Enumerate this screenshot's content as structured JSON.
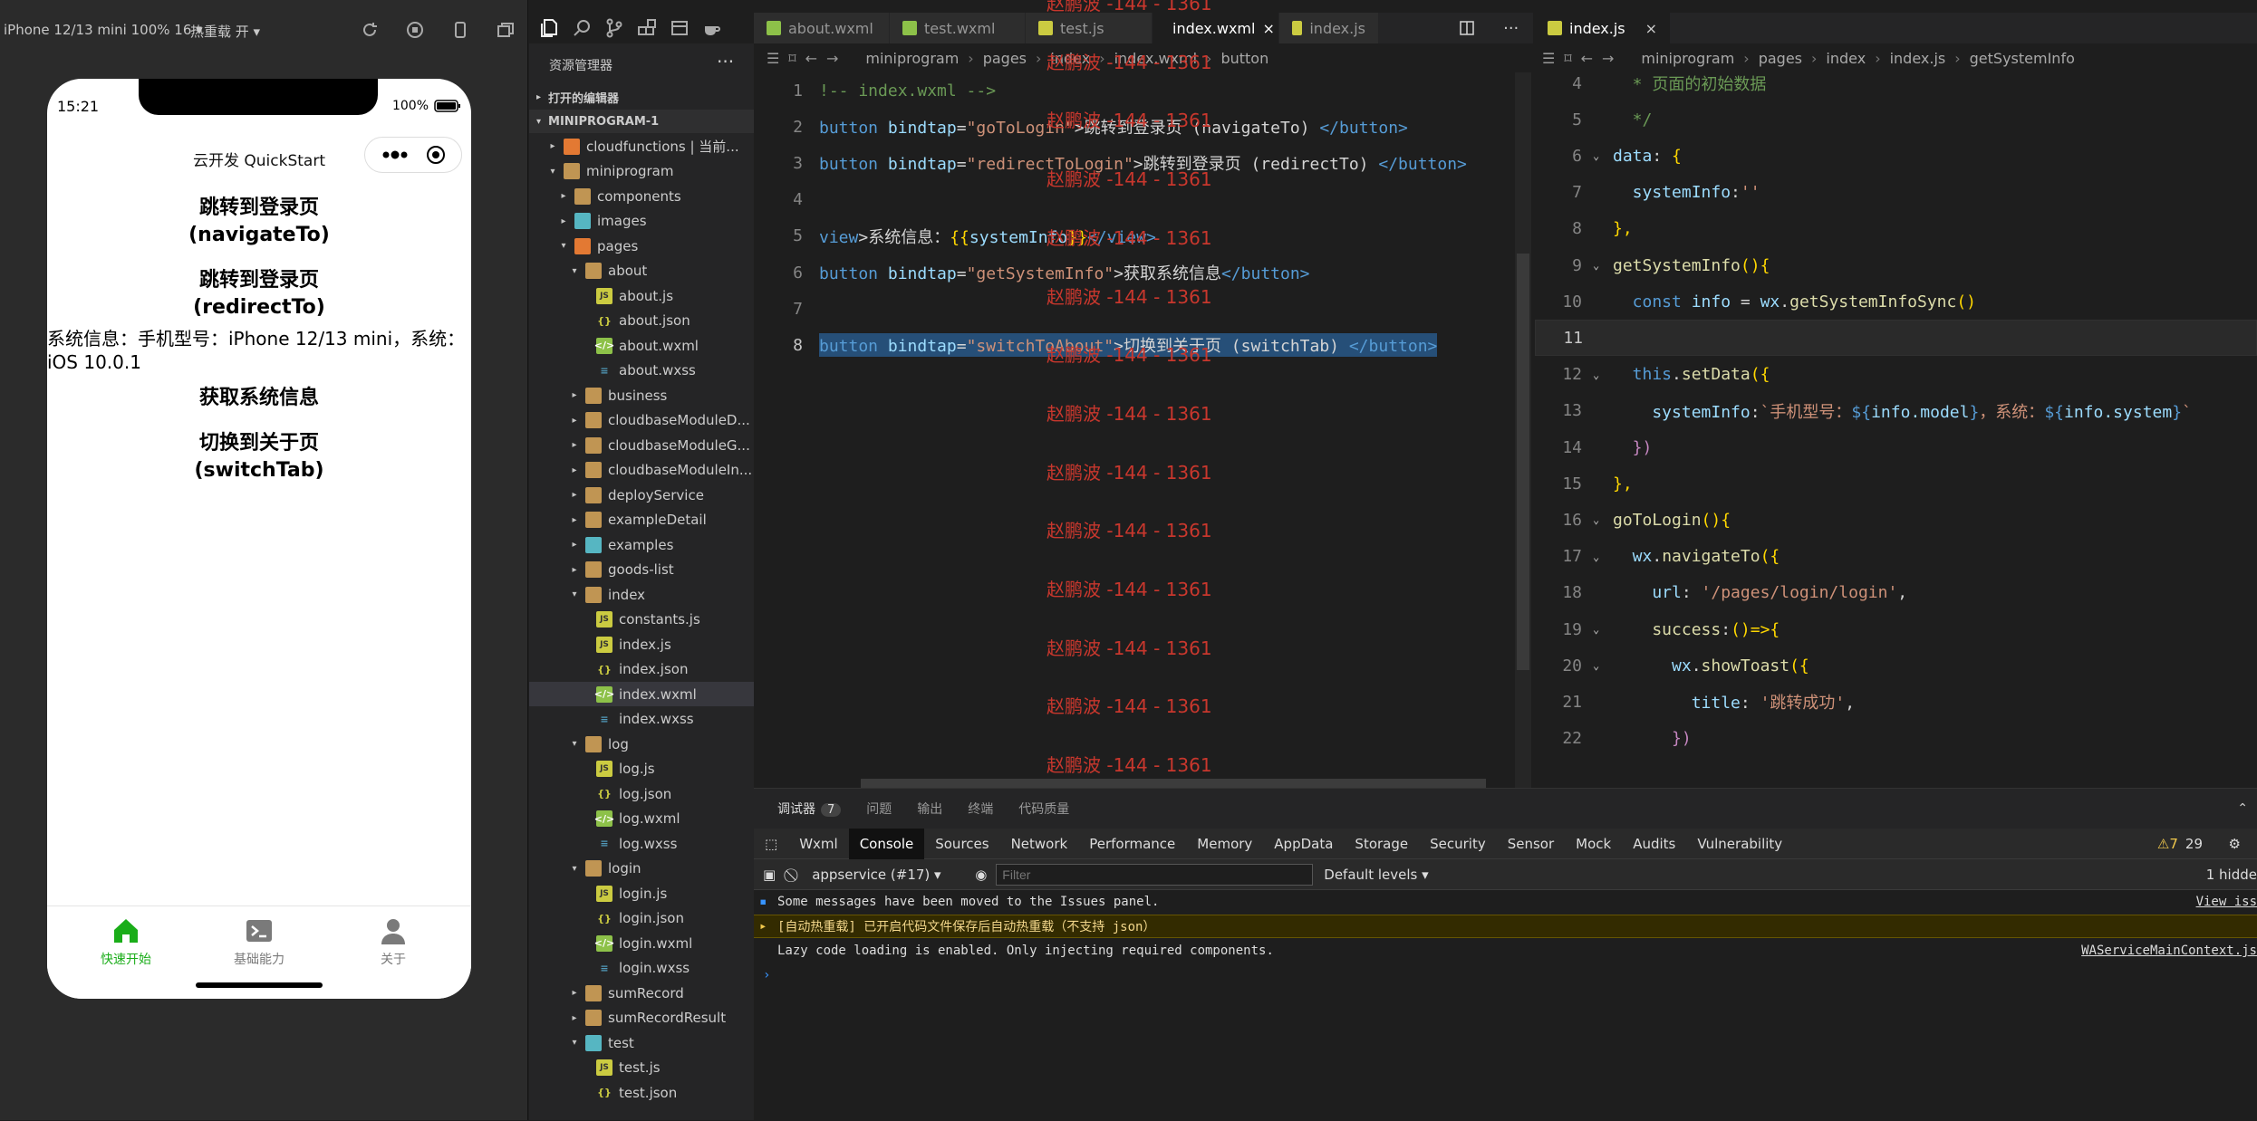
{
  "simulator": {
    "device_select": "iPhone 12/13 mini 100% 16 ▾",
    "hot_reload": "热重载 开 ▾",
    "status_time": "15:21",
    "battery": "100%",
    "nav_title": "云开发 QuickStart",
    "buttons": [
      "跳转到登录页\n(navigateTo)",
      "跳转到登录页\n(redirectTo)",
      "获取系统信息",
      "切换到关于页\n(switchTab)"
    ],
    "sysinfo": "系统信息：手机型号：iPhone 12/13 mini，系统：iOS 10.0.1",
    "tabbar": [
      {
        "label": "快速开始",
        "icon": "home-icon",
        "active": true
      },
      {
        "label": "基础能力",
        "icon": "terminal-icon",
        "active": false
      },
      {
        "label": "关于",
        "icon": "user-icon",
        "active": false
      }
    ]
  },
  "explorer": {
    "title": "资源管理器",
    "more": "···",
    "open_editors": "打开的编辑器",
    "project": "MINIPROGRAM-1",
    "items": [
      {
        "label": "cloudfunctions | 当前...",
        "depth": 1,
        "type": "folder4",
        "arrow": "▸"
      },
      {
        "label": "miniprogram",
        "depth": 1,
        "type": "folder",
        "arrow": "▾"
      },
      {
        "label": "components",
        "depth": 2,
        "type": "folder",
        "arrow": "▸"
      },
      {
        "label": "images",
        "depth": 2,
        "type": "folder3",
        "arrow": "▸"
      },
      {
        "label": "pages",
        "depth": 2,
        "type": "folder4",
        "arrow": "▾"
      },
      {
        "label": "about",
        "depth": 3,
        "type": "folder",
        "arrow": "▾"
      },
      {
        "label": "about.js",
        "depth": 4,
        "type": "js",
        "arrow": ""
      },
      {
        "label": "about.json",
        "depth": 4,
        "type": "json",
        "arrow": ""
      },
      {
        "label": "about.wxml",
        "depth": 4,
        "type": "wxml",
        "arrow": ""
      },
      {
        "label": "about.wxss",
        "depth": 4,
        "type": "wxss",
        "arrow": ""
      },
      {
        "label": "business",
        "depth": 3,
        "type": "folder",
        "arrow": "▸"
      },
      {
        "label": "cloudbaseModuleD...",
        "depth": 3,
        "type": "folder",
        "arrow": "▸"
      },
      {
        "label": "cloudbaseModuleG...",
        "depth": 3,
        "type": "folder",
        "arrow": "▸"
      },
      {
        "label": "cloudbaseModuleIn...",
        "depth": 3,
        "type": "folder",
        "arrow": "▸"
      },
      {
        "label": "deployService",
        "depth": 3,
        "type": "folder",
        "arrow": "▸"
      },
      {
        "label": "exampleDetail",
        "depth": 3,
        "type": "folder",
        "arrow": "▸"
      },
      {
        "label": "examples",
        "depth": 3,
        "type": "folder3",
        "arrow": "▸"
      },
      {
        "label": "goods-list",
        "depth": 3,
        "type": "folder",
        "arrow": "▸"
      },
      {
        "label": "index",
        "depth": 3,
        "type": "folder",
        "arrow": "▾"
      },
      {
        "label": "constants.js",
        "depth": 4,
        "type": "js",
        "arrow": ""
      },
      {
        "label": "index.js",
        "depth": 4,
        "type": "js",
        "arrow": ""
      },
      {
        "label": "index.json",
        "depth": 4,
        "type": "json",
        "arrow": ""
      },
      {
        "label": "index.wxml",
        "depth": 4,
        "type": "wxml",
        "arrow": "",
        "selected": true
      },
      {
        "label": "index.wxss",
        "depth": 4,
        "type": "wxss",
        "arrow": ""
      },
      {
        "label": "log",
        "depth": 3,
        "type": "folder",
        "arrow": "▾"
      },
      {
        "label": "log.js",
        "depth": 4,
        "type": "js",
        "arrow": ""
      },
      {
        "label": "log.json",
        "depth": 4,
        "type": "json",
        "arrow": ""
      },
      {
        "label": "log.wxml",
        "depth": 4,
        "type": "wxml",
        "arrow": ""
      },
      {
        "label": "log.wxss",
        "depth": 4,
        "type": "wxss",
        "arrow": ""
      },
      {
        "label": "login",
        "depth": 3,
        "type": "folder",
        "arrow": "▾"
      },
      {
        "label": "login.js",
        "depth": 4,
        "type": "js",
        "arrow": ""
      },
      {
        "label": "login.json",
        "depth": 4,
        "type": "json",
        "arrow": ""
      },
      {
        "label": "login.wxml",
        "depth": 4,
        "type": "wxml",
        "arrow": ""
      },
      {
        "label": "login.wxss",
        "depth": 4,
        "type": "wxss",
        "arrow": ""
      },
      {
        "label": "sumRecord",
        "depth": 3,
        "type": "folder",
        "arrow": "▸"
      },
      {
        "label": "sumRecordResult",
        "depth": 3,
        "type": "folder",
        "arrow": "▸"
      },
      {
        "label": "test",
        "depth": 3,
        "type": "folder3",
        "arrow": "▾"
      },
      {
        "label": "test.js",
        "depth": 4,
        "type": "js",
        "arrow": ""
      },
      {
        "label": "test.json",
        "depth": 4,
        "type": "json",
        "arrow": ""
      }
    ]
  },
  "editor1": {
    "tabs": [
      {
        "label": "about.wxml",
        "type": "wxml",
        "active": false
      },
      {
        "label": "test.wxml",
        "type": "wxml",
        "active": false
      },
      {
        "label": "test.js",
        "type": "js",
        "active": false
      },
      {
        "label": "index.wxml",
        "type": "wxml",
        "active": true
      },
      {
        "label": "index.js",
        "type": "js",
        "active": false
      }
    ],
    "breadcrumb": [
      "miniprogram",
      "pages",
      "index",
      "index.wxml",
      "button"
    ],
    "lines": [
      {
        "n": "1",
        "tokens": [
          [
            "c",
            "!-- index.wxml -->"
          ]
        ]
      },
      {
        "n": "2",
        "tokens": [
          [
            "t",
            "button "
          ],
          [
            "a",
            "bindtap"
          ],
          [
            "x",
            "="
          ],
          [
            "s",
            "\"goToLogin\""
          ],
          [
            "x",
            ">跳转到登录页 (navigateTo) "
          ],
          [
            "t",
            "</button>"
          ]
        ]
      },
      {
        "n": "3",
        "tokens": [
          [
            "t",
            "button "
          ],
          [
            "a",
            "bindtap"
          ],
          [
            "x",
            "="
          ],
          [
            "s",
            "\"redirectToLogin\""
          ],
          [
            "x",
            ">跳转到登录页 (redirectTo) "
          ],
          [
            "t",
            "</button>"
          ]
        ]
      },
      {
        "n": "4",
        "tokens": []
      },
      {
        "n": "5",
        "tokens": [
          [
            "t",
            "view"
          ],
          [
            "x",
            ">系统信息："
          ],
          [
            "y",
            "{{"
          ],
          [
            "a",
            "systemInfo"
          ],
          [
            "y",
            "}}"
          ],
          [
            "t",
            "</view>"
          ]
        ]
      },
      {
        "n": "6",
        "tokens": [
          [
            "t",
            "button "
          ],
          [
            "a",
            "bindtap"
          ],
          [
            "x",
            "="
          ],
          [
            "s",
            "\"getSystemInfo\""
          ],
          [
            "x",
            ">获取系统信息"
          ],
          [
            "t",
            "</button>"
          ]
        ]
      },
      {
        "n": "7",
        "tokens": []
      },
      {
        "n": "8",
        "tokens": [
          [
            "t",
            "button "
          ],
          [
            "a",
            "bindtap"
          ],
          [
            "x",
            "="
          ],
          [
            "s",
            "\"switchToAbout\""
          ],
          [
            "x",
            ">切换到关于页 (switchTab) "
          ],
          [
            "t",
            "</button>"
          ]
        ],
        "current": true
      }
    ],
    "watermark": "赵鹏波 -144 - 1361"
  },
  "editor2": {
    "tab": "index.js",
    "breadcrumb": [
      "miniprogram",
      "pages",
      "index",
      "index.js",
      "getSystemInfo"
    ],
    "lines": [
      {
        "n": "4",
        "fold": "",
        "tokens": [
          [
            "c",
            "  * 页面的初始数据"
          ]
        ]
      },
      {
        "n": "5",
        "fold": "",
        "tokens": [
          [
            "c",
            "  */"
          ]
        ]
      },
      {
        "n": "6",
        "fold": "⌄",
        "tokens": [
          [
            "a",
            "data"
          ],
          [
            "x",
            ": "
          ],
          [
            "y",
            "{"
          ]
        ]
      },
      {
        "n": "7",
        "fold": "",
        "tokens": [
          [
            "a",
            "  systemInfo"
          ],
          [
            "x",
            ":"
          ],
          [
            "s",
            "''"
          ]
        ]
      },
      {
        "n": "8",
        "fold": "",
        "tokens": [
          [
            "y",
            "},"
          ]
        ]
      },
      {
        "n": "9",
        "fold": "⌄",
        "tokens": [
          [
            "f",
            "getSystemInfo"
          ],
          [
            "y",
            "(){"
          ]
        ]
      },
      {
        "n": "10",
        "fold": "",
        "tokens": [
          [
            "t",
            "  const "
          ],
          [
            "a",
            "info"
          ],
          [
            "x",
            " = "
          ],
          [
            "a",
            "wx"
          ],
          [
            "x",
            "."
          ],
          [
            "f",
            "getSystemInfoSync"
          ],
          [
            "y",
            "()"
          ]
        ]
      },
      {
        "n": "11",
        "fold": "",
        "tokens": [],
        "current": true
      },
      {
        "n": "12",
        "fold": "⌄",
        "tokens": [
          [
            "t",
            "  this"
          ],
          [
            "x",
            "."
          ],
          [
            "f",
            "setData"
          ],
          [
            "y",
            "({"
          ]
        ]
      },
      {
        "n": "13",
        "fold": "",
        "tokens": [
          [
            "a",
            "    systemInfo"
          ],
          [
            "x",
            ":"
          ],
          [
            "s",
            "`手机型号："
          ],
          [
            "t",
            "${"
          ],
          [
            "a",
            "info.model"
          ],
          [
            "t",
            "}"
          ],
          [
            "s",
            "，系统："
          ],
          [
            "t",
            "${"
          ],
          [
            "a",
            "info.system"
          ],
          [
            "t",
            "}"
          ],
          [
            "s",
            "`"
          ]
        ]
      },
      {
        "n": "14",
        "fold": "",
        "tokens": [
          [
            "k",
            "  })"
          ]
        ]
      },
      {
        "n": "15",
        "fold": "",
        "tokens": [
          [
            "y",
            "},"
          ]
        ]
      },
      {
        "n": "16",
        "fold": "⌄",
        "tokens": [
          [
            "f",
            "goToLogin"
          ],
          [
            "y",
            "(){"
          ]
        ]
      },
      {
        "n": "17",
        "fold": "⌄",
        "tokens": [
          [
            "a",
            "  wx"
          ],
          [
            "x",
            "."
          ],
          [
            "f",
            "navigateTo"
          ],
          [
            "y",
            "({"
          ]
        ]
      },
      {
        "n": "18",
        "fold": "",
        "tokens": [
          [
            "a",
            "    url"
          ],
          [
            "x",
            ": "
          ],
          [
            "s",
            "'/pages/login/login'"
          ],
          [
            "x",
            ","
          ]
        ]
      },
      {
        "n": "19",
        "fold": "⌄",
        "tokens": [
          [
            "f",
            "    success"
          ],
          [
            "x",
            ":"
          ],
          [
            "y",
            "()=>{"
          ]
        ]
      },
      {
        "n": "20",
        "fold": "⌄",
        "tokens": [
          [
            "a",
            "      wx"
          ],
          [
            "x",
            "."
          ],
          [
            "f",
            "showToast"
          ],
          [
            "y",
            "({"
          ]
        ]
      },
      {
        "n": "21",
        "fold": "",
        "tokens": [
          [
            "a",
            "        title"
          ],
          [
            "x",
            ": "
          ],
          [
            "s",
            "'跳转成功'"
          ],
          [
            "x",
            ","
          ]
        ]
      },
      {
        "n": "22",
        "fold": "",
        "tokens": [
          [
            "k",
            "      })"
          ]
        ]
      }
    ]
  },
  "panel": {
    "tabs": [
      {
        "label": "调试器",
        "badge": "7",
        "active": true
      },
      {
        "label": "问题"
      },
      {
        "label": "输出"
      },
      {
        "label": "终端"
      },
      {
        "label": "代码质量"
      }
    ],
    "devtools_tabs": [
      "Wxml",
      "Console",
      "Sources",
      "Network",
      "Performance",
      "Memory",
      "AppData",
      "Storage",
      "Security",
      "Sensor",
      "Mock",
      "Audits",
      "Vulnerability"
    ],
    "active_devtool": "Console",
    "warn_count": "⚠7",
    "msg_count": "29",
    "context": "appservice (#17)",
    "filter_placeholder": "Filter",
    "levels": "Default levels ▾",
    "hidden": "1 hidde",
    "console": [
      {
        "text": "Some messages have been moved to the Issues panel.",
        "right": "View iss",
        "kind": "info"
      },
      {
        "text": "[自动热重载] 已开启代码文件保存后自动热重载（不支持 json）",
        "right": "",
        "kind": "warn"
      },
      {
        "text": "Lazy code loading is enabled. Only injecting required components.",
        "right": "WAServiceMainContext.js",
        "kind": "log"
      }
    ],
    "prompt": "›"
  },
  "colors": {
    "accent_green": "#1aad19",
    "warn_bg": "#332b00",
    "watermark": "#c8372d"
  }
}
